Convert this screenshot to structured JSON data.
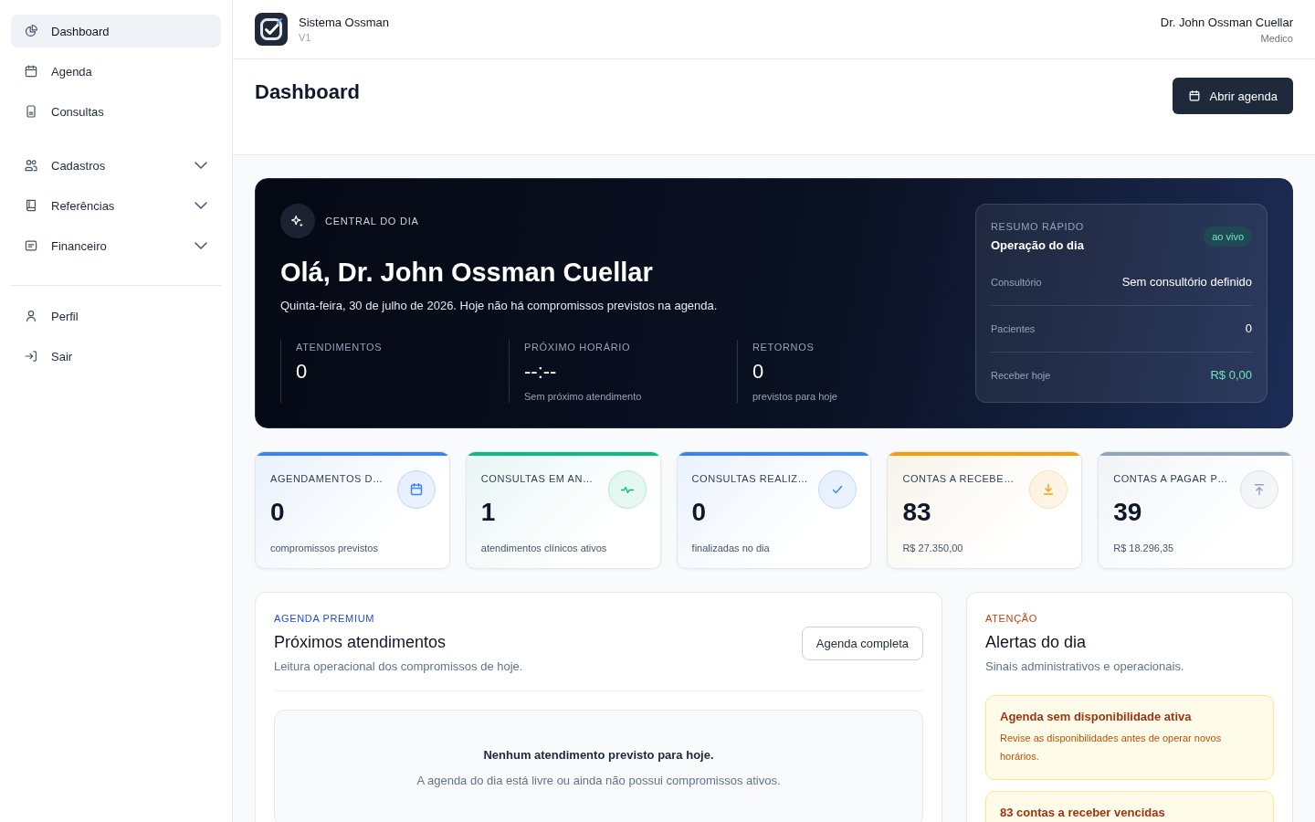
{
  "sidebar": {
    "sections": [
      {
        "items": [
          {
            "label": "Dashboard",
            "selected": true
          },
          {
            "label": "Agenda",
            "selected": false
          },
          {
            "label": "Consultas",
            "selected": false
          }
        ]
      },
      {
        "items": [
          {
            "label": "Cadastros",
            "selected": false,
            "expanded": false
          },
          {
            "label": "Referências",
            "selected": false,
            "expanded": false
          },
          {
            "label": "Financeiro",
            "selected": false,
            "expanded": false
          }
        ]
      },
      {
        "items": [
          {
            "label": "Perfil",
            "selected": false
          },
          {
            "label": "Sair",
            "selected": false
          }
        ]
      }
    ]
  },
  "topbar": {
    "app_name": "Sistema Ossman",
    "version": "V1",
    "user_name": "Dr. John Ossman Cuellar",
    "user_role": "Medico"
  },
  "page_header": {
    "title": "Dashboard",
    "action": "Abrir agenda"
  },
  "hero": {
    "eyebrow": "CENTRAL DO DIA",
    "title": "Olá, Dr. John Ossman Cuellar",
    "subtitle": "Quinta-feira, 30 de julho de 2026. Hoje não há compromissos previstos na agenda.",
    "stats": [
      {
        "label": "ATENDIMENTOS",
        "value": "0"
      },
      {
        "label": "PRÓXIMO HORÁRIO",
        "value": "--:--",
        "note": "Sem próximo atendimento"
      },
      {
        "label": "RETORNOS",
        "value": "0",
        "note": "previstos para hoje"
      }
    ],
    "summary": {
      "eyebrow": "RESUMO RÁPIDO",
      "title": "Operação do dia",
      "badge": "ao vivo",
      "rows": [
        {
          "label": "Consultório",
          "value": "Sem consultório definido",
          "highlight": false
        },
        {
          "label": "Pacientes",
          "value": "0",
          "highlight": false
        },
        {
          "label": "Receber hoje",
          "value": "R$ 0,00",
          "highlight": true
        }
      ]
    }
  },
  "kpis": [
    {
      "title": "AGENDAMENTOS D…",
      "value": "0",
      "note": "compromissos previstos",
      "color": "#3b82f6"
    },
    {
      "title": "CONSULTAS EM AN…",
      "value": "1",
      "note": "atendimentos clínicos ativos",
      "color": "#10b981"
    },
    {
      "title": "CONSULTAS REALIZ…",
      "value": "0",
      "note": "finalizadas no dia",
      "color": "#3b82f6"
    },
    {
      "title": "CONTAS A RECEBE…",
      "value": "83",
      "note": "R$ 27.350,00",
      "color": "#f59e0b"
    },
    {
      "title": "CONTAS A PAGAR P…",
      "value": "39",
      "note": "R$ 18.296,35",
      "color": "#94a3b8"
    }
  ],
  "appointments": {
    "eyebrow": "AGENDA PREMIUM",
    "title": "Próximos atendimentos",
    "subtitle": "Leitura operacional dos compromissos de hoje.",
    "action": "Agenda completa",
    "empty": {
      "title": "Nenhum atendimento previsto para hoje.",
      "text": "A agenda do dia está livre ou ainda não possui compromissos ativos."
    }
  },
  "alerts": {
    "eyebrow": "ATENÇÃO",
    "title": "Alertas do dia",
    "subtitle": "Sinais administrativos e operacionais.",
    "items": [
      {
        "title": "Agenda sem disponibilidade ativa",
        "text": "Revise as disponibilidades antes de operar novos horários."
      },
      {
        "title": "83 contas a receber vencidas"
      }
    ]
  }
}
